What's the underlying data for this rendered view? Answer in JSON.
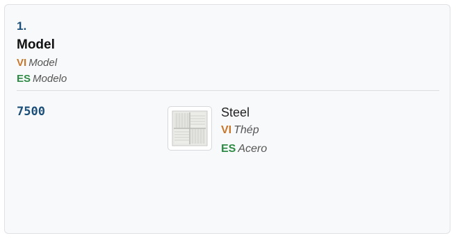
{
  "field": {
    "number": "1.",
    "title": "Model",
    "translations": [
      {
        "lang": "VI",
        "text": "Model"
      },
      {
        "lang": "ES",
        "text": "Modelo"
      }
    ]
  },
  "entry": {
    "code": "7500",
    "material": "Steel",
    "translations": [
      {
        "lang": "VI",
        "text": "Thép"
      },
      {
        "lang": "ES",
        "text": "Acero"
      }
    ],
    "image_icon": "diffuser-grille-icon"
  },
  "colors": {
    "accent_blue": "#1b4f7a",
    "vi_label": "#c8762a",
    "es_label": "#2d8a45"
  }
}
